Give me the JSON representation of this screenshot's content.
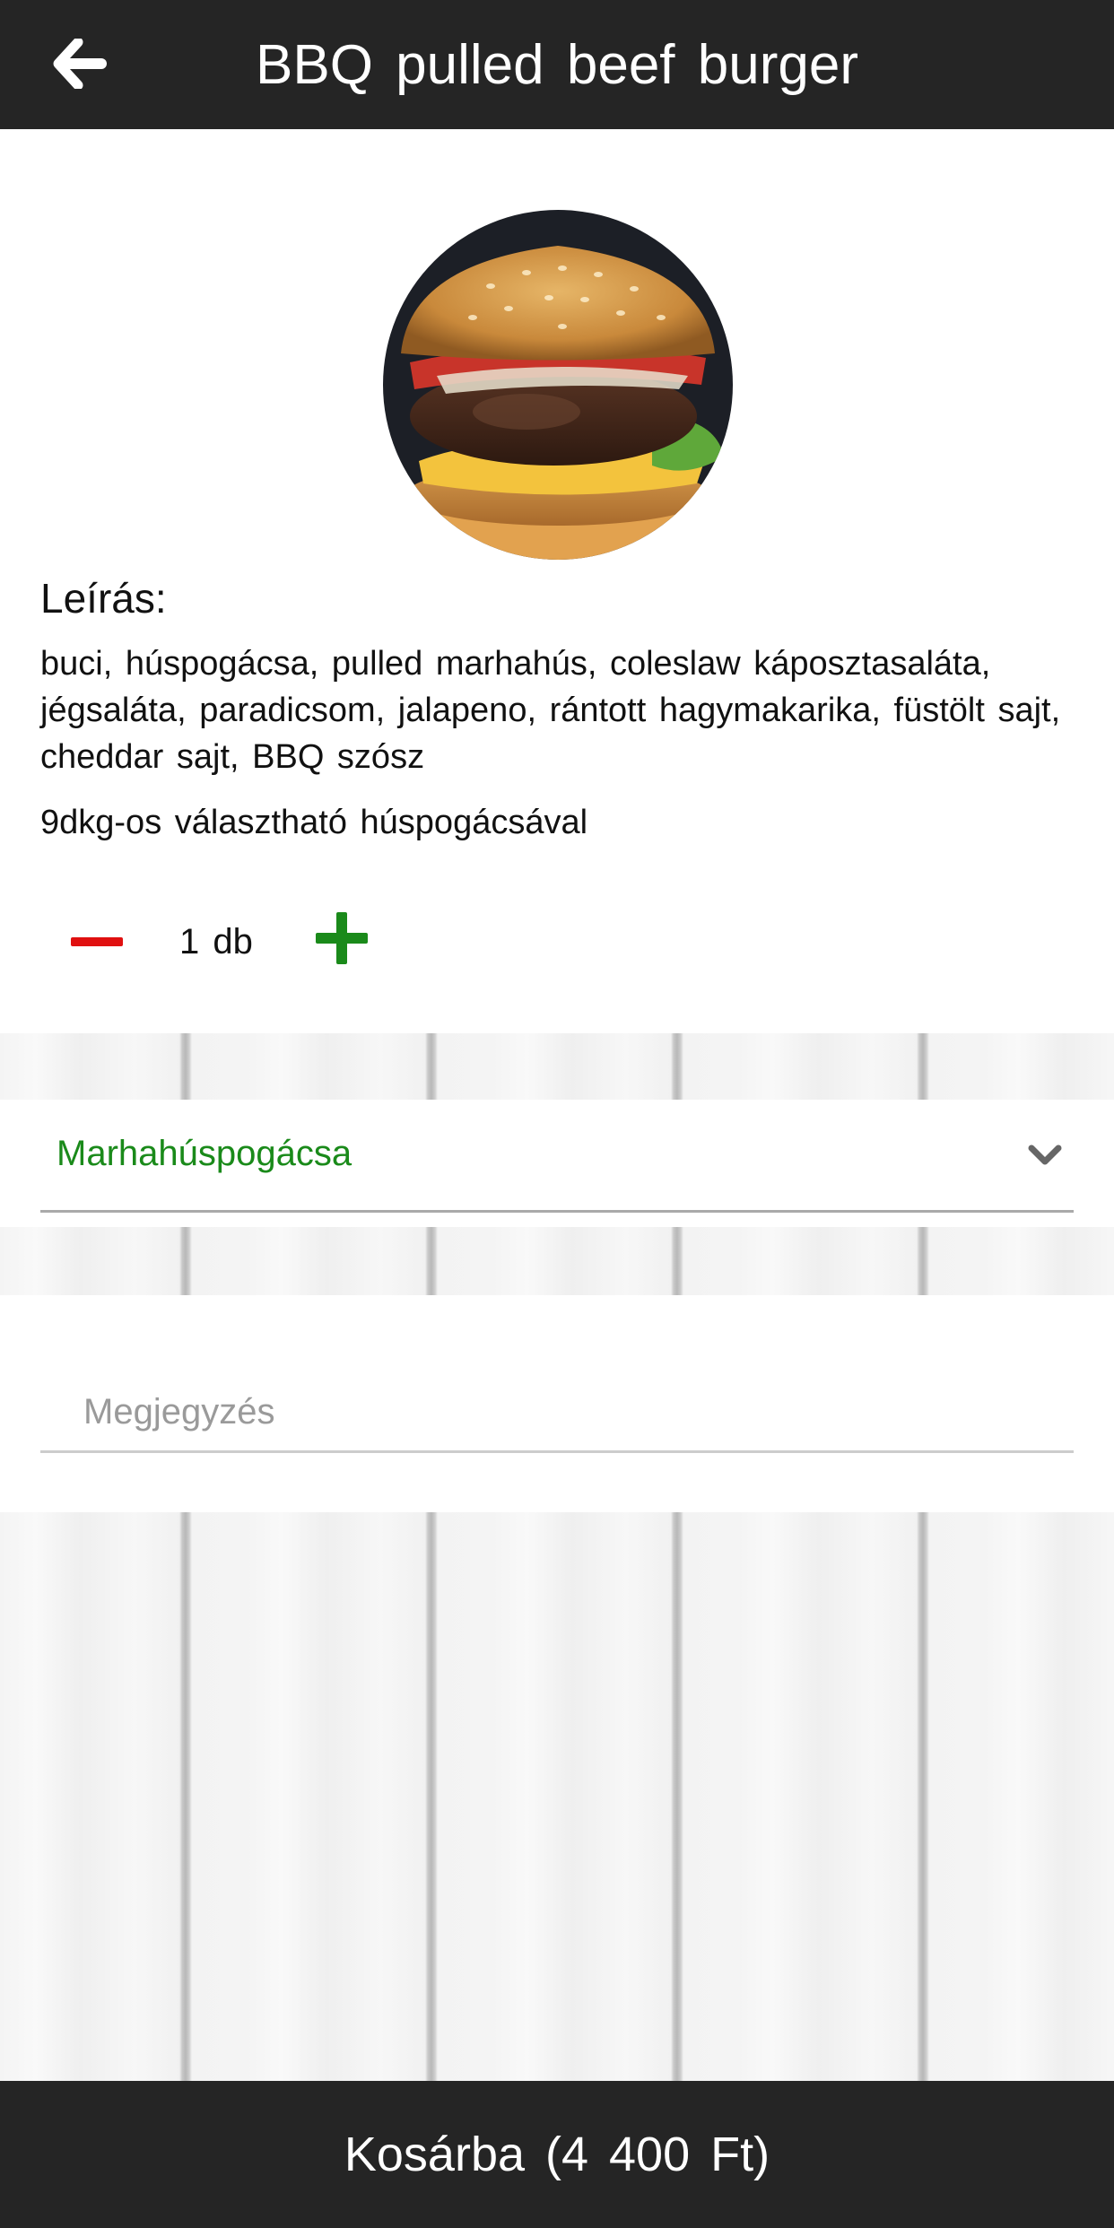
{
  "header": {
    "back_icon": "arrow-left-icon",
    "title": "BBQ pulled beef burger"
  },
  "product": {
    "image": "burger-photo",
    "description_heading": "Leírás:",
    "description": "buci, húspogácsa, pulled marhahús, coleslaw káposztasaláta, jégsaláta, paradicsom, jalapeno, rántott hagymakarika, füstölt sajt, cheddar sajt, BBQ szósz",
    "note": "9dkg-os választható húspogácsával",
    "quantity": "1 db"
  },
  "options": {
    "selected": "Marhahúspogácsa",
    "chevron_icon": "chevron-down-icon"
  },
  "comment": {
    "placeholder": "Megjegyzés",
    "value": ""
  },
  "footer": {
    "cart_label": "Kosárba (4 400 Ft)"
  },
  "colors": {
    "bar": "#252525",
    "minus": "#e01010",
    "plus": "#1a8a1a",
    "selected_text": "#1a8a1a"
  }
}
